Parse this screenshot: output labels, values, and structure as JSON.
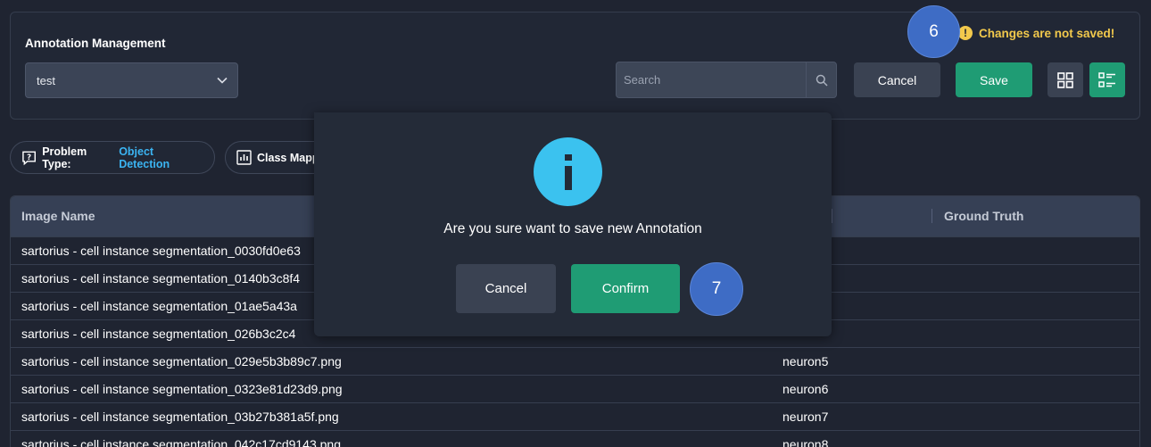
{
  "header": {
    "title": "Annotation Management",
    "project_value": "test",
    "search_placeholder": "Search",
    "cancel_label": "Cancel",
    "save_label": "Save",
    "warning_text": "Changes are not saved!",
    "warning_icon": "!"
  },
  "steps": {
    "step6": "6",
    "step7": "7"
  },
  "chips": {
    "problem_label": "Problem Type:",
    "problem_value": "Object Detection",
    "class_label": "Class Mapp"
  },
  "table": {
    "headers": {
      "image_name": "Image Name",
      "ground_truth": "Ground Truth"
    },
    "rows": [
      {
        "image": "sartorius - cell instance segmentation_0030fd0e63",
        "label": ""
      },
      {
        "image": "sartorius - cell instance segmentation_0140b3c8f4",
        "label": ""
      },
      {
        "image": "sartorius - cell instance segmentation_01ae5a43a",
        "label": ""
      },
      {
        "image": "sartorius - cell instance segmentation_026b3c2c4",
        "label": ""
      },
      {
        "image": "sartorius - cell instance segmentation_029e5b3b89c7.png",
        "label": "neuron5"
      },
      {
        "image": "sartorius - cell instance segmentation_0323e81d23d9.png",
        "label": "neuron6"
      },
      {
        "image": "sartorius - cell instance segmentation_03b27b381a5f.png",
        "label": "neuron7"
      },
      {
        "image": "sartorius - cell instance segmentation_042c17cd9143.png",
        "label": "neuron8"
      }
    ]
  },
  "modal": {
    "icon_glyph": "i",
    "message": "Are you sure want to save new Annotation",
    "cancel_label": "Cancel",
    "confirm_label": "Confirm"
  },
  "colors": {
    "background": "#1f2431",
    "accent_green": "#1f9c74",
    "info_blue": "#3bc2ef",
    "warning_yellow": "#f2c94c",
    "step_badge": "#3e6cc5",
    "link_blue": "#3bb4f2"
  }
}
